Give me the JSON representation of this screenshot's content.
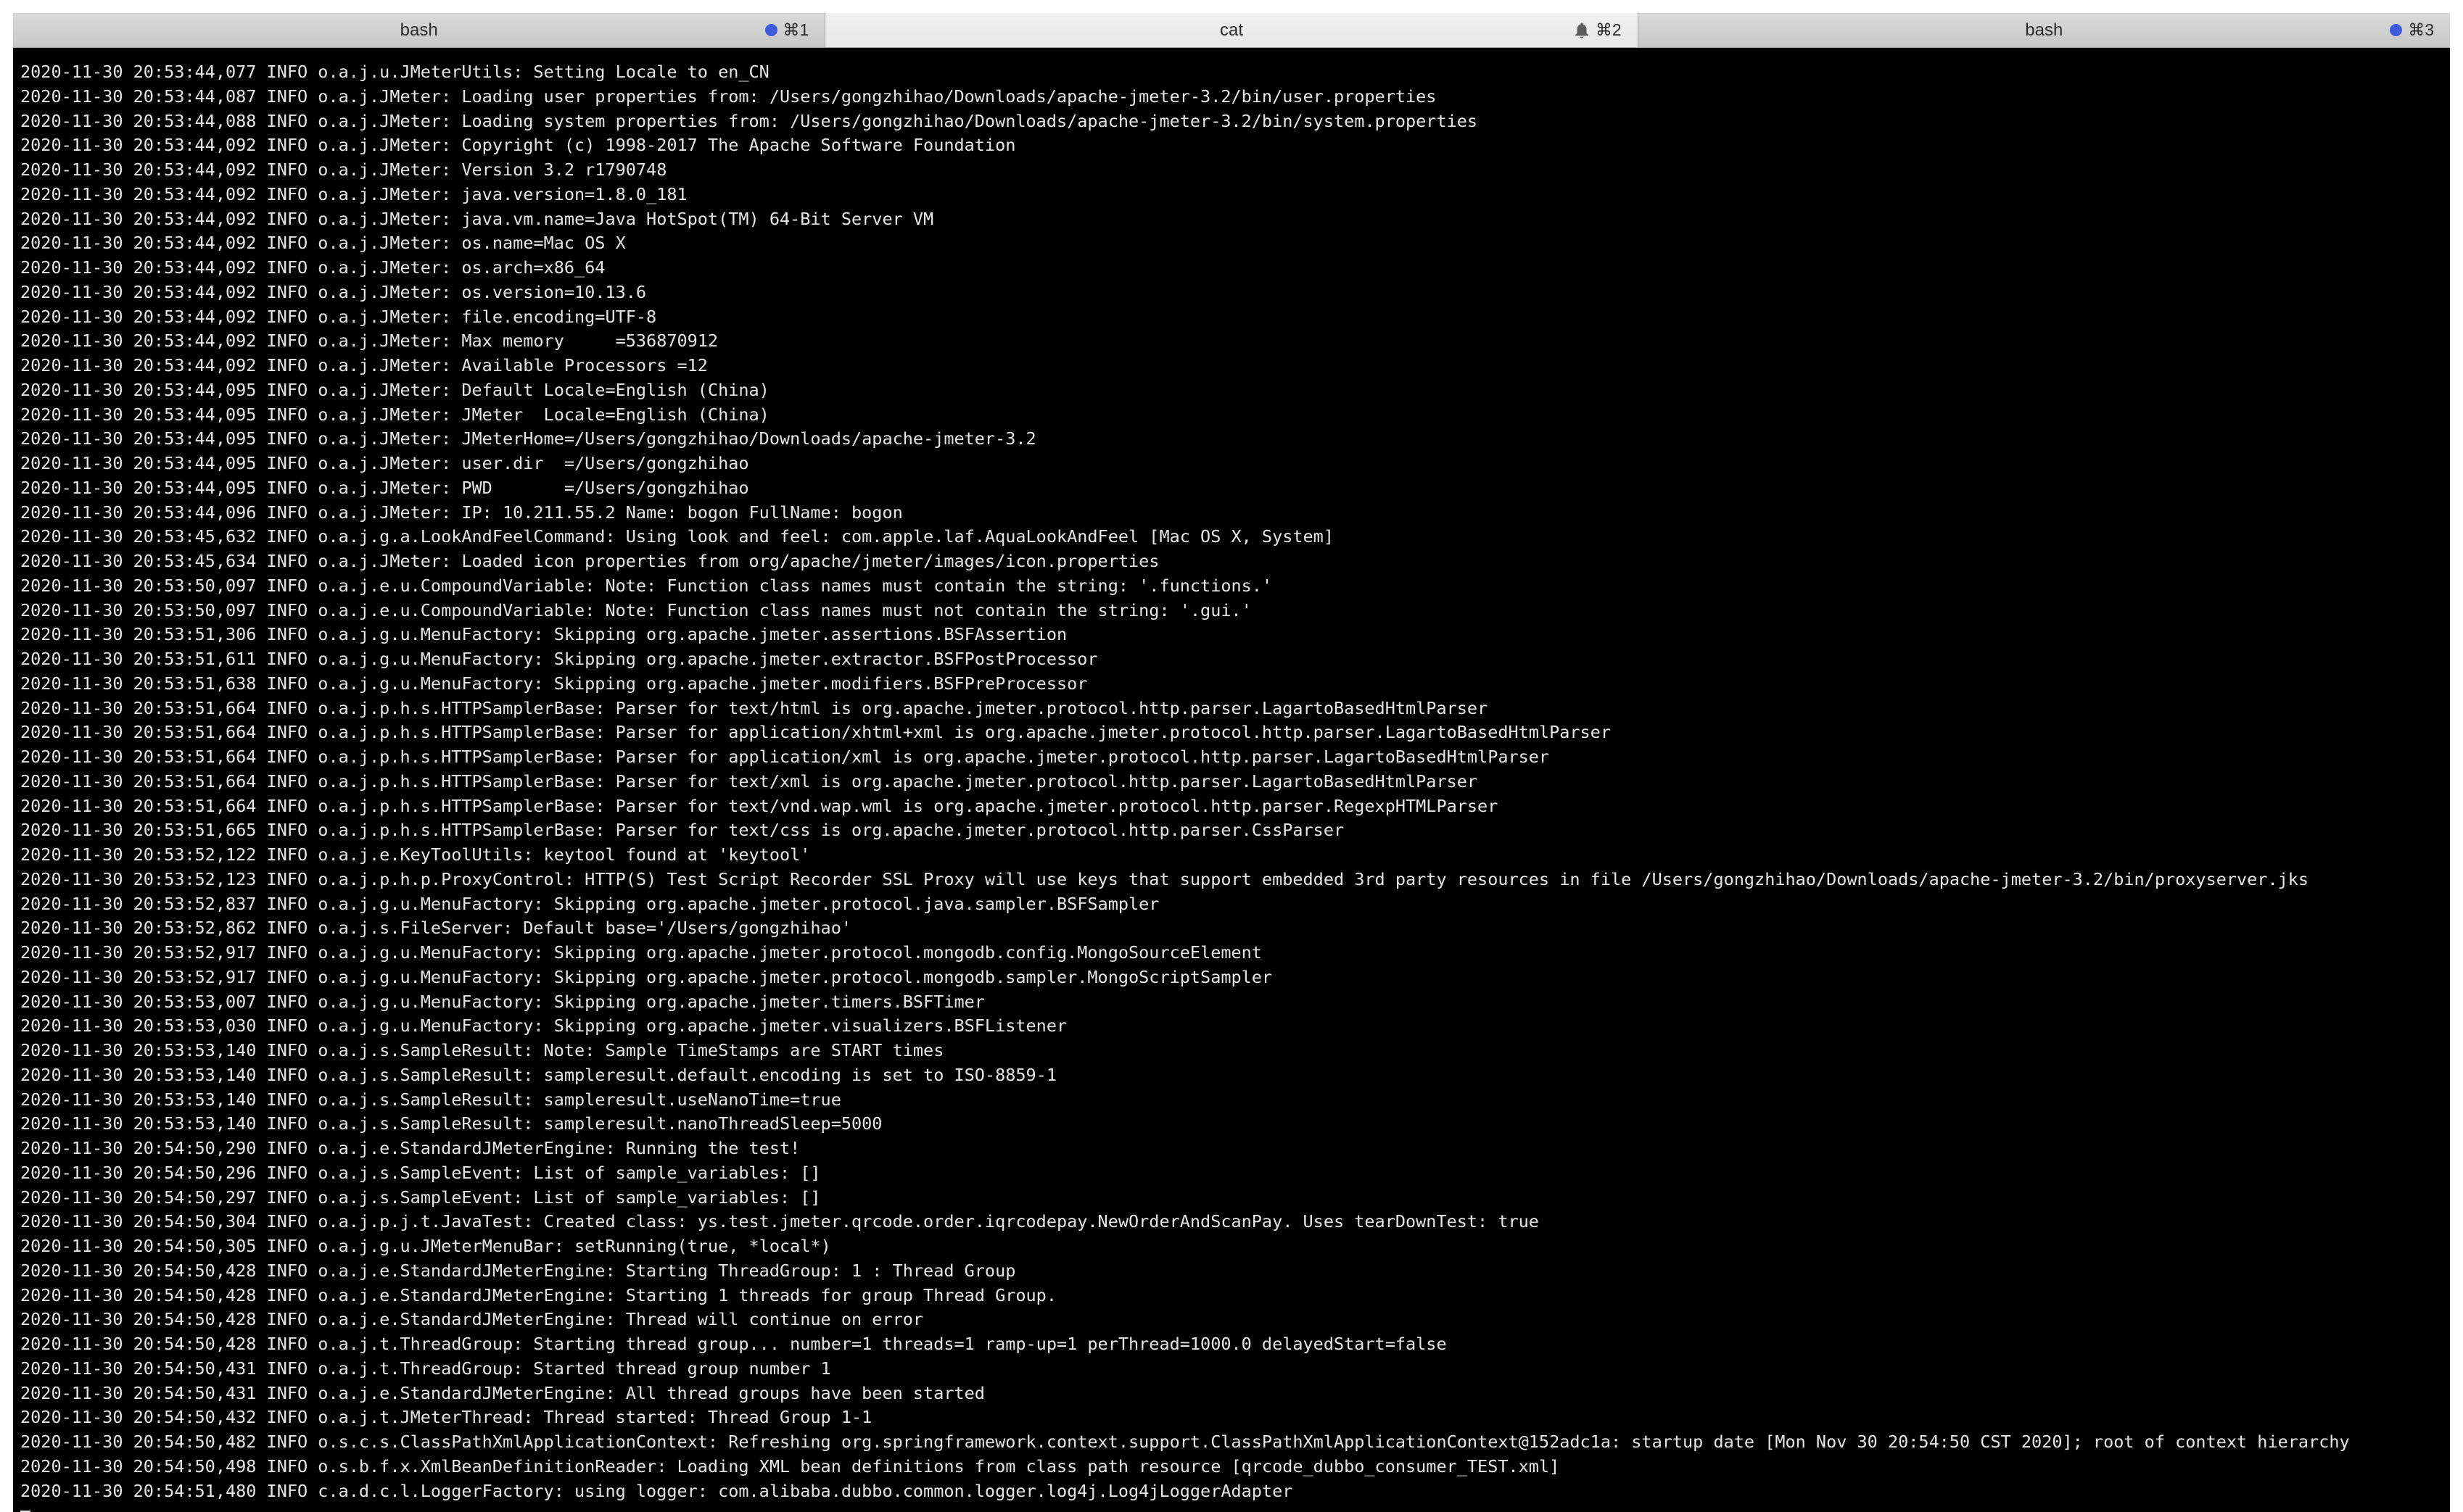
{
  "tabs": [
    {
      "title": "bash",
      "shortcut": "⌘1",
      "indicator": "blue-dot",
      "active": false
    },
    {
      "title": "cat",
      "shortcut": "⌘2",
      "indicator": "bell",
      "active": true
    },
    {
      "title": "bash",
      "shortcut": "⌘3",
      "indicator": "blue-dot",
      "active": false
    }
  ],
  "colors": {
    "terminal_bg": "#000000",
    "terminal_fg": "#e6e6e6",
    "indicator_dot": "#3d5bdc"
  },
  "terminal": {
    "lines": [
      "2020-11-30 20:53:44,077 INFO o.a.j.u.JMeterUtils: Setting Locale to en_CN",
      "2020-11-30 20:53:44,087 INFO o.a.j.JMeter: Loading user properties from: /Users/gongzhihao/Downloads/apache-jmeter-3.2/bin/user.properties",
      "2020-11-30 20:53:44,088 INFO o.a.j.JMeter: Loading system properties from: /Users/gongzhihao/Downloads/apache-jmeter-3.2/bin/system.properties",
      "2020-11-30 20:53:44,092 INFO o.a.j.JMeter: Copyright (c) 1998-2017 The Apache Software Foundation",
      "2020-11-30 20:53:44,092 INFO o.a.j.JMeter: Version 3.2 r1790748",
      "2020-11-30 20:53:44,092 INFO o.a.j.JMeter: java.version=1.8.0_181",
      "2020-11-30 20:53:44,092 INFO o.a.j.JMeter: java.vm.name=Java HotSpot(TM) 64-Bit Server VM",
      "2020-11-30 20:53:44,092 INFO o.a.j.JMeter: os.name=Mac OS X",
      "2020-11-30 20:53:44,092 INFO o.a.j.JMeter: os.arch=x86_64",
      "2020-11-30 20:53:44,092 INFO o.a.j.JMeter: os.version=10.13.6",
      "2020-11-30 20:53:44,092 INFO o.a.j.JMeter: file.encoding=UTF-8",
      "2020-11-30 20:53:44,092 INFO o.a.j.JMeter: Max memory     =536870912",
      "2020-11-30 20:53:44,092 INFO o.a.j.JMeter: Available Processors =12",
      "2020-11-30 20:53:44,095 INFO o.a.j.JMeter: Default Locale=English (China)",
      "2020-11-30 20:53:44,095 INFO o.a.j.JMeter: JMeter  Locale=English (China)",
      "2020-11-30 20:53:44,095 INFO o.a.j.JMeter: JMeterHome=/Users/gongzhihao/Downloads/apache-jmeter-3.2",
      "2020-11-30 20:53:44,095 INFO o.a.j.JMeter: user.dir  =/Users/gongzhihao",
      "2020-11-30 20:53:44,095 INFO o.a.j.JMeter: PWD       =/Users/gongzhihao",
      "2020-11-30 20:53:44,096 INFO o.a.j.JMeter: IP: 10.211.55.2 Name: bogon FullName: bogon",
      "2020-11-30 20:53:45,632 INFO o.a.j.g.a.LookAndFeelCommand: Using look and feel: com.apple.laf.AquaLookAndFeel [Mac OS X, System]",
      "2020-11-30 20:53:45,634 INFO o.a.j.JMeter: Loaded icon properties from org/apache/jmeter/images/icon.properties",
      "2020-11-30 20:53:50,097 INFO o.a.j.e.u.CompoundVariable: Note: Function class names must contain the string: '.functions.'",
      "2020-11-30 20:53:50,097 INFO o.a.j.e.u.CompoundVariable: Note: Function class names must not contain the string: '.gui.'",
      "2020-11-30 20:53:51,306 INFO o.a.j.g.u.MenuFactory: Skipping org.apache.jmeter.assertions.BSFAssertion",
      "2020-11-30 20:53:51,611 INFO o.a.j.g.u.MenuFactory: Skipping org.apache.jmeter.extractor.BSFPostProcessor",
      "2020-11-30 20:53:51,638 INFO o.a.j.g.u.MenuFactory: Skipping org.apache.jmeter.modifiers.BSFPreProcessor",
      "2020-11-30 20:53:51,664 INFO o.a.j.p.h.s.HTTPSamplerBase: Parser for text/html is org.apache.jmeter.protocol.http.parser.LagartoBasedHtmlParser",
      "2020-11-30 20:53:51,664 INFO o.a.j.p.h.s.HTTPSamplerBase: Parser for application/xhtml+xml is org.apache.jmeter.protocol.http.parser.LagartoBasedHtmlParser",
      "2020-11-30 20:53:51,664 INFO o.a.j.p.h.s.HTTPSamplerBase: Parser for application/xml is org.apache.jmeter.protocol.http.parser.LagartoBasedHtmlParser",
      "2020-11-30 20:53:51,664 INFO o.a.j.p.h.s.HTTPSamplerBase: Parser for text/xml is org.apache.jmeter.protocol.http.parser.LagartoBasedHtmlParser",
      "2020-11-30 20:53:51,664 INFO o.a.j.p.h.s.HTTPSamplerBase: Parser for text/vnd.wap.wml is org.apache.jmeter.protocol.http.parser.RegexpHTMLParser",
      "2020-11-30 20:53:51,665 INFO o.a.j.p.h.s.HTTPSamplerBase: Parser for text/css is org.apache.jmeter.protocol.http.parser.CssParser",
      "2020-11-30 20:53:52,122 INFO o.a.j.e.KeyToolUtils: keytool found at 'keytool'",
      "2020-11-30 20:53:52,123 INFO o.a.j.p.h.p.ProxyControl: HTTP(S) Test Script Recorder SSL Proxy will use keys that support embedded 3rd party resources in file /Users/gongzhihao/Downloads/apache-jmeter-3.2/bin/proxyserver.jks",
      "2020-11-30 20:53:52,837 INFO o.a.j.g.u.MenuFactory: Skipping org.apache.jmeter.protocol.java.sampler.BSFSampler",
      "2020-11-30 20:53:52,862 INFO o.a.j.s.FileServer: Default base='/Users/gongzhihao'",
      "2020-11-30 20:53:52,917 INFO o.a.j.g.u.MenuFactory: Skipping org.apache.jmeter.protocol.mongodb.config.MongoSourceElement",
      "2020-11-30 20:53:52,917 INFO o.a.j.g.u.MenuFactory: Skipping org.apache.jmeter.protocol.mongodb.sampler.MongoScriptSampler",
      "2020-11-30 20:53:53,007 INFO o.a.j.g.u.MenuFactory: Skipping org.apache.jmeter.timers.BSFTimer",
      "2020-11-30 20:53:53,030 INFO o.a.j.g.u.MenuFactory: Skipping org.apache.jmeter.visualizers.BSFListener",
      "2020-11-30 20:53:53,140 INFO o.a.j.s.SampleResult: Note: Sample TimeStamps are START times",
      "2020-11-30 20:53:53,140 INFO o.a.j.s.SampleResult: sampleresult.default.encoding is set to ISO-8859-1",
      "2020-11-30 20:53:53,140 INFO o.a.j.s.SampleResult: sampleresult.useNanoTime=true",
      "2020-11-30 20:53:53,140 INFO o.a.j.s.SampleResult: sampleresult.nanoThreadSleep=5000",
      "2020-11-30 20:54:50,290 INFO o.a.j.e.StandardJMeterEngine: Running the test!",
      "2020-11-30 20:54:50,296 INFO o.a.j.s.SampleEvent: List of sample_variables: []",
      "2020-11-30 20:54:50,297 INFO o.a.j.s.SampleEvent: List of sample_variables: []",
      "2020-11-30 20:54:50,304 INFO o.a.j.p.j.t.JavaTest: Created class: ys.test.jmeter.qrcode.order.iqrcodepay.NewOrderAndScanPay. Uses tearDownTest: true",
      "2020-11-30 20:54:50,305 INFO o.a.j.g.u.JMeterMenuBar: setRunning(true, *local*)",
      "2020-11-30 20:54:50,428 INFO o.a.j.e.StandardJMeterEngine: Starting ThreadGroup: 1 : Thread Group",
      "2020-11-30 20:54:50,428 INFO o.a.j.e.StandardJMeterEngine: Starting 1 threads for group Thread Group.",
      "2020-11-30 20:54:50,428 INFO o.a.j.e.StandardJMeterEngine: Thread will continue on error",
      "2020-11-30 20:54:50,428 INFO o.a.j.t.ThreadGroup: Starting thread group... number=1 threads=1 ramp-up=1 perThread=1000.0 delayedStart=false",
      "2020-11-30 20:54:50,431 INFO o.a.j.t.ThreadGroup: Started thread group number 1",
      "2020-11-30 20:54:50,431 INFO o.a.j.e.StandardJMeterEngine: All thread groups have been started",
      "2020-11-30 20:54:50,432 INFO o.a.j.t.JMeterThread: Thread started: Thread Group 1-1",
      "2020-11-30 20:54:50,482 INFO o.s.c.s.ClassPathXmlApplicationContext: Refreshing org.springframework.context.support.ClassPathXmlApplicationContext@152adc1a: startup date [Mon Nov 30 20:54:50 CST 2020]; root of context hierarchy",
      "2020-11-30 20:54:50,498 INFO o.s.b.f.x.XmlBeanDefinitionReader: Loading XML bean definitions from class path resource [qrcode_dubbo_consumer_TEST.xml]",
      "2020-11-30 20:54:51,480 INFO c.a.d.c.l.LoggerFactory: using logger: com.alibaba.dubbo.common.logger.log4j.Log4jLoggerAdapter"
    ]
  }
}
